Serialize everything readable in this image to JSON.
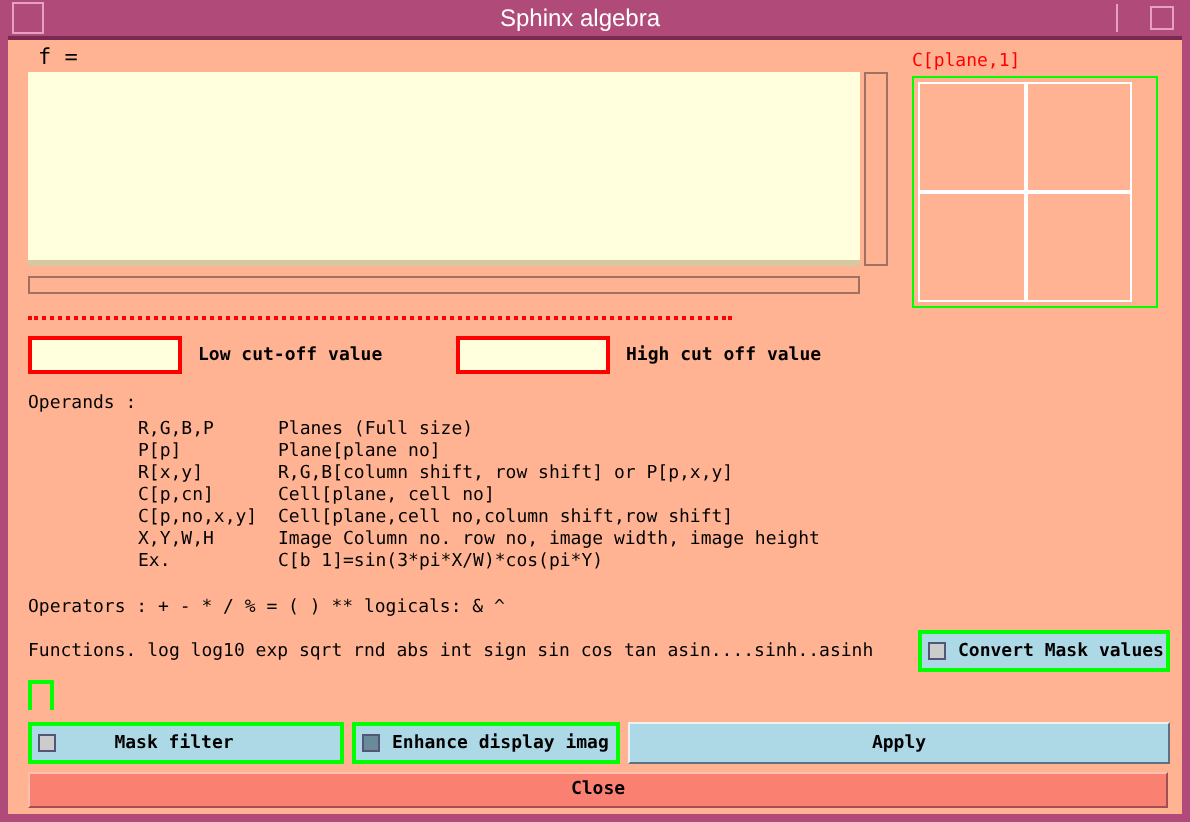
{
  "window": {
    "title": "Sphinx algebra"
  },
  "expression": {
    "label": "f ="
  },
  "preview": {
    "label": "C[plane,1]"
  },
  "cutoffs": [
    {
      "label": "Low cut-off value"
    },
    {
      "label": "High cut off value"
    }
  ],
  "operands": {
    "heading": "Operands :",
    "rows": [
      {
        "symbol": "R,G,B,P",
        "meaning": "Planes (Full size)"
      },
      {
        "symbol": "P[p]",
        "meaning": "Plane[plane no]"
      },
      {
        "symbol": "R[x,y]",
        "meaning": "R,G,B[column shift, row shift] or P[p,x,y]"
      },
      {
        "symbol": "C[p,cn]",
        "meaning": "Cell[plane, cell no]"
      },
      {
        "symbol": "C[p,no,x,y]",
        "meaning": "Cell[plane,cell no,column shift,row shift]"
      },
      {
        "symbol": "X,Y,W,H",
        "meaning": "Image  Column no. row no, image width, image height"
      },
      {
        "symbol": "Ex.",
        "meaning": "C[b 1]=sin(3*pi*X/W)*cos(pi*Y)"
      }
    ]
  },
  "operators": "Operators : + - * / % = ( ) ** logicals: &  ^",
  "functions": "Functions. log log10 exp sqrt rnd abs int sign sin cos tan asin....sinh..asinh",
  "checkboxes": [
    {
      "label": "Convert Mask values",
      "checked": false
    },
    {
      "label": "Mask filter",
      "checked": false
    },
    {
      "label": "Enhance display imag",
      "checked": true
    }
  ],
  "buttons": [
    {
      "label": "Apply",
      "kind": "apply"
    },
    {
      "label": "Close",
      "kind": "close"
    }
  ]
}
